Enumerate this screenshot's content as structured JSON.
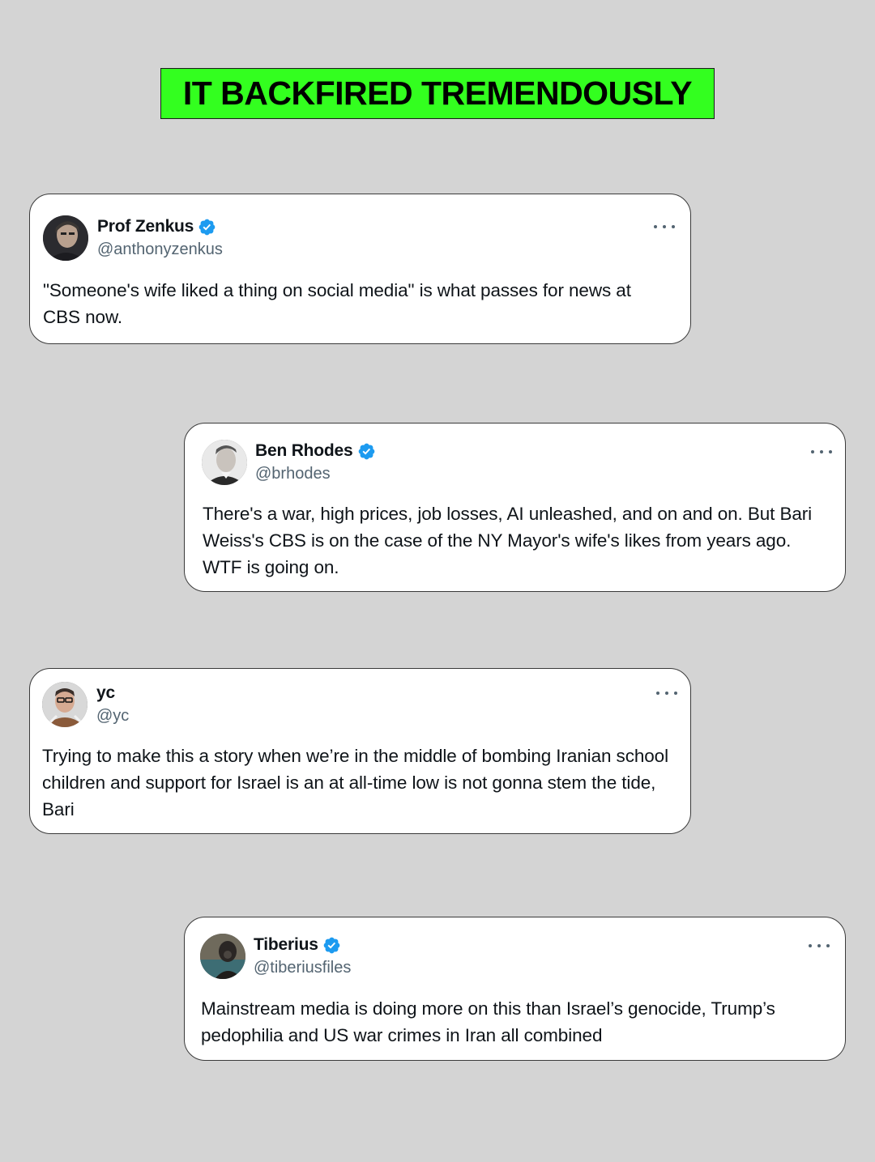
{
  "headline": "IT BACKFIRED TREMENDOUSLY",
  "colors": {
    "background": "#d4d4d4",
    "headline_bg": "#33ff1f",
    "verified_blue": "#1d9bf0",
    "handle_gray": "#536471",
    "text": "#0f1419"
  },
  "tweets": [
    {
      "name": "Prof Zenkus",
      "handle": "@anthonyzenkus",
      "verified": true,
      "text": "\"Someone's wife liked a thing on social media\" is what passes for news at CBS now."
    },
    {
      "name": "Ben Rhodes",
      "handle": "@brhodes",
      "verified": true,
      "text": "There's a war, high prices, job losses, AI unleashed, and on and on. But Bari Weiss's CBS is on the case of the NY Mayor's wife's likes from years ago. WTF is going on."
    },
    {
      "name": "yc",
      "handle": "@yc",
      "verified": false,
      "text": "Trying to make this a story when we’re in the middle of bombing Iranian school children and support for Israel is an at all-time low is not gonna stem the tide, Bari"
    },
    {
      "name": "Tiberius",
      "handle": "@tiberiusfiles",
      "verified": true,
      "text": "Mainstream media is doing more on this than Israel’s genocide, Trump’s pedophilia and US war crimes in Iran all combined"
    }
  ],
  "icons": {
    "verified": "verified-badge-icon",
    "more": "more-options-icon",
    "avatar": "user-avatar"
  }
}
